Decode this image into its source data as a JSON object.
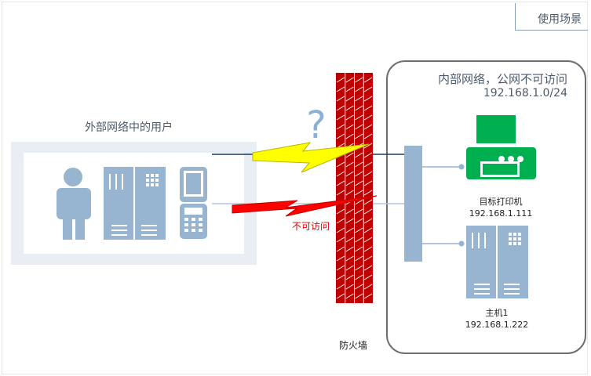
{
  "header": {
    "title": "使用场景"
  },
  "external": {
    "label": "外部网络中的用户"
  },
  "internal": {
    "title": "内部网络，公网不可访问",
    "subnet": "192.168.1.0/24"
  },
  "firewall": {
    "label": "防火墙"
  },
  "question_mark": "?",
  "blocked_label": "不可访问",
  "printer": {
    "name": "目标打印机",
    "ip": "192.168.1.111",
    "color": "#00b050"
  },
  "host": {
    "name": "主机1",
    "ip": "192.168.1.222"
  },
  "colors": {
    "device": "#97b4d0",
    "firewall": "#c00000",
    "attack_ok": "#ffff00",
    "attack_blocked": "#ff0000"
  },
  "icons": [
    "person-icon",
    "server-icon",
    "tablet-icon",
    "phone-icon",
    "printer-icon",
    "host-server-icon",
    "switch-icon",
    "firewall-icon",
    "lightning-icon"
  ]
}
